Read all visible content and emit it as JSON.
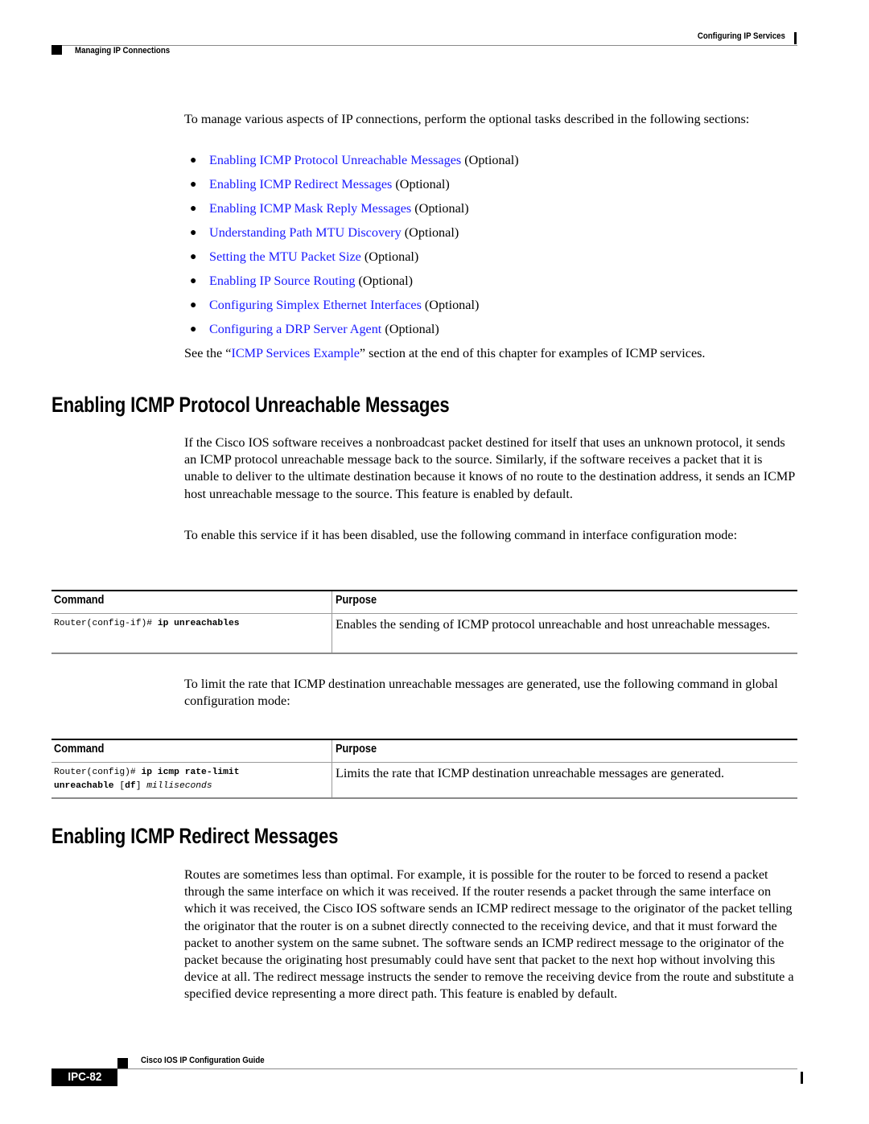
{
  "header": {
    "chapter_title": "Configuring IP Services",
    "section_title": "Managing IP Connections"
  },
  "intro": {
    "text": "To manage various aspects of IP connections, perform the optional tasks described in the following sections:",
    "tasks": [
      {
        "link": "Enabling ICMP Protocol Unreachable Messages",
        "suffix": " (Optional)"
      },
      {
        "link": "Enabling ICMP Redirect Messages",
        "suffix": " (Optional)"
      },
      {
        "link": "Enabling ICMP Mask Reply Messages",
        "suffix": " (Optional)"
      },
      {
        "link": "Understanding Path MTU Discovery",
        "suffix": " (Optional)"
      },
      {
        "link": "Setting the MTU Packet Size",
        "suffix": " (Optional)"
      },
      {
        "link": "Enabling IP Source Routing",
        "suffix": " (Optional)"
      },
      {
        "link": "Configuring Simplex Ethernet Interfaces",
        "suffix": " (Optional)"
      },
      {
        "link": "Configuring a DRP Server Agent",
        "suffix": " (Optional)"
      }
    ],
    "see_also": {
      "prefix": "See the “",
      "link": "ICMP Services Example",
      "suffix": "” section at the end of this chapter for examples of ICMP services."
    }
  },
  "section1": {
    "heading": "Enabling ICMP Protocol Unreachable Messages",
    "para1": "If the Cisco IOS software receives a nonbroadcast packet destined for itself that uses an unknown protocol, it sends an ICMP protocol unreachable message back to the source. Similarly, if the software receives a packet that it is unable to deliver to the ultimate destination because it knows of no route to the destination address, it sends an ICMP host unreachable message to the source. This feature is enabled by default.",
    "para2": "To enable this service if it has been disabled, use the following command in interface configuration mode:",
    "table1": {
      "headers": [
        "Command",
        "Purpose"
      ],
      "rows": [
        {
          "command_prompt": "Router(config-if)# ",
          "command_keyword": "ip unreachables",
          "purpose": "Enables the sending of ICMP protocol unreachable and host unreachable messages."
        }
      ]
    },
    "para3": "To limit the rate that ICMP destination unreachable messages are generated, use the following command in global configuration mode:",
    "table2": {
      "headers": [
        "Command",
        "Purpose"
      ],
      "rows": [
        {
          "command_prompt": "Router(config)# ",
          "command_keyword1": "ip icmp rate-limit",
          "command_keyword2": "unreachable",
          "command_opt_open": " [",
          "command_opt": "df",
          "command_opt_close": "] ",
          "command_arg": "milliseconds",
          "purpose": "Limits the rate that ICMP destination unreachable messages are generated."
        }
      ]
    }
  },
  "section2": {
    "heading": "Enabling ICMP Redirect Messages",
    "para1": "Routes are sometimes less than optimal. For example, it is possible for the router to be forced to resend a packet through the same interface on which it was received. If the router resends a packet through the same interface on which it was received, the Cisco IOS software sends an ICMP redirect message to the originator of the packet telling the originator that the router is on a subnet directly connected to the receiving device, and that it must forward the packet to another system on the same subnet. The software sends an ICMP redirect message to the originator of the packet because the originating host presumably could have sent that packet to the next hop without involving this device at all. The redirect message instructs the sender to remove the receiving device from the route and substitute a specified device representing a more direct path. This feature is enabled by default."
  },
  "footer": {
    "book_title": "Cisco IOS IP Configuration Guide",
    "page_number": "IPC-82"
  },
  "colors": {
    "link": "#1a1aff",
    "text": "#000000",
    "rule_gray": "#8a8a8a"
  }
}
